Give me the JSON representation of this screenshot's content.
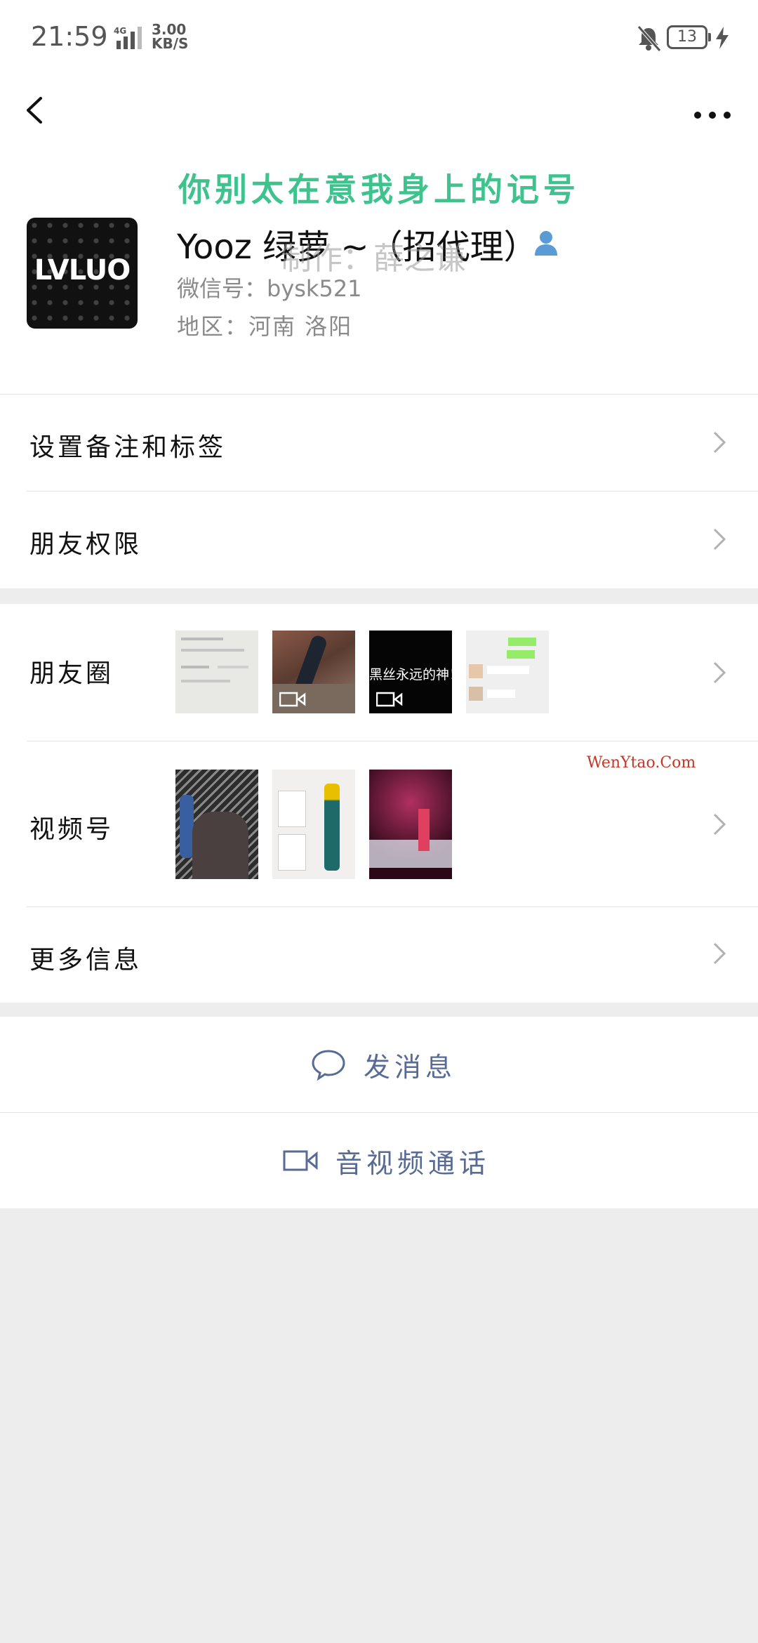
{
  "status_bar": {
    "time": "21:59",
    "network": "4G",
    "speed_value": "3.00",
    "speed_unit": "KB/S",
    "battery": "13"
  },
  "profile": {
    "slogan": "你别太在意我身上的记号",
    "avatar_text": "LVLUO",
    "name": "Yooz 绿萝 ~（招代理）",
    "watermark": "制作：薛之谦",
    "wechat_id": "微信号：bysk521",
    "region": "地区：河南 洛阳"
  },
  "menu": {
    "remark": "设置备注和标签",
    "permission": "朋友权限",
    "moments": "朋友圈",
    "channels": "视频号",
    "more_info": "更多信息"
  },
  "moments_thumbs": [
    {
      "kind": "document",
      "video": false
    },
    {
      "kind": "hand",
      "video": true
    },
    {
      "kind": "caption",
      "video": true,
      "caption": "黑丝永远的神！"
    },
    {
      "kind": "chat",
      "video": false
    }
  ],
  "channel_thumbs": [
    "dark-pattern",
    "product-box",
    "stage-light"
  ],
  "site_mark": "WenYtao.Com",
  "actions": {
    "message": "发消息",
    "call": "音视频通话"
  },
  "colors": {
    "link_blue": "#576b95",
    "slogan_green": "#3ec38e",
    "background": "#ededed"
  }
}
